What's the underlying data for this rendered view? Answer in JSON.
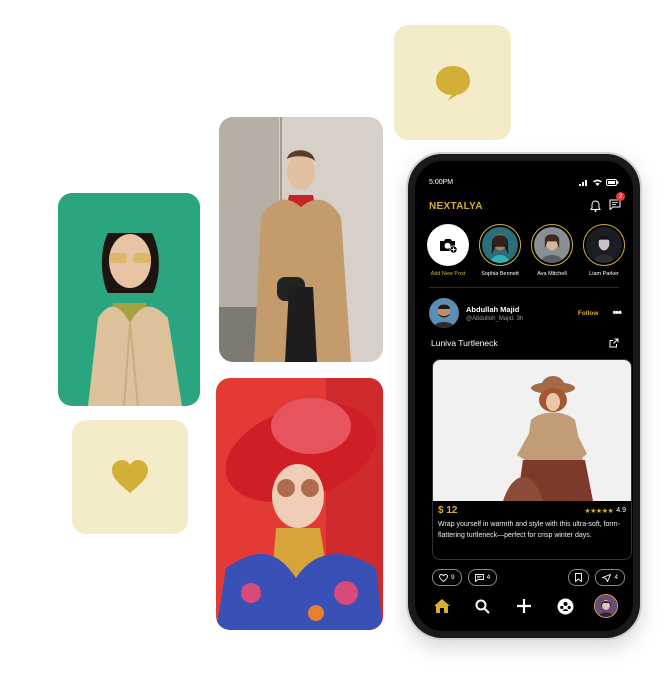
{
  "app": {
    "brand": "NEXTALYA",
    "status_time": "5:00PM",
    "notification_badge": "2"
  },
  "stories": [
    {
      "label": "Add New Post",
      "type": "add"
    },
    {
      "label": "Sophia Bennett",
      "type": "user"
    },
    {
      "label": "Ava Mitchell",
      "type": "user"
    },
    {
      "label": "Liam Parker",
      "type": "user"
    }
  ],
  "post": {
    "author": "Abdullah Majid",
    "handle": "@Abdulloh_Majid. 3h",
    "follow_label": "Follow",
    "title": "Luniva Turtleneck",
    "price": "$ 12",
    "rating": "4.9",
    "description": "Wrap yourself in warmth and style with this ultra-soft, form-flattering turtleneck—perfect for crisp winter days.",
    "likes": "9",
    "comments": "4",
    "shares": "4"
  },
  "nav": [
    "home-icon",
    "search-icon",
    "add-icon",
    "community-icon",
    "profile-avatar"
  ],
  "colors": {
    "gold": "#d4af37",
    "tile": "#f4ebc9",
    "screen": "#000000"
  },
  "icons": {
    "chat_tile": "chat-bubble-icon",
    "heart_tile": "heart-icon"
  }
}
